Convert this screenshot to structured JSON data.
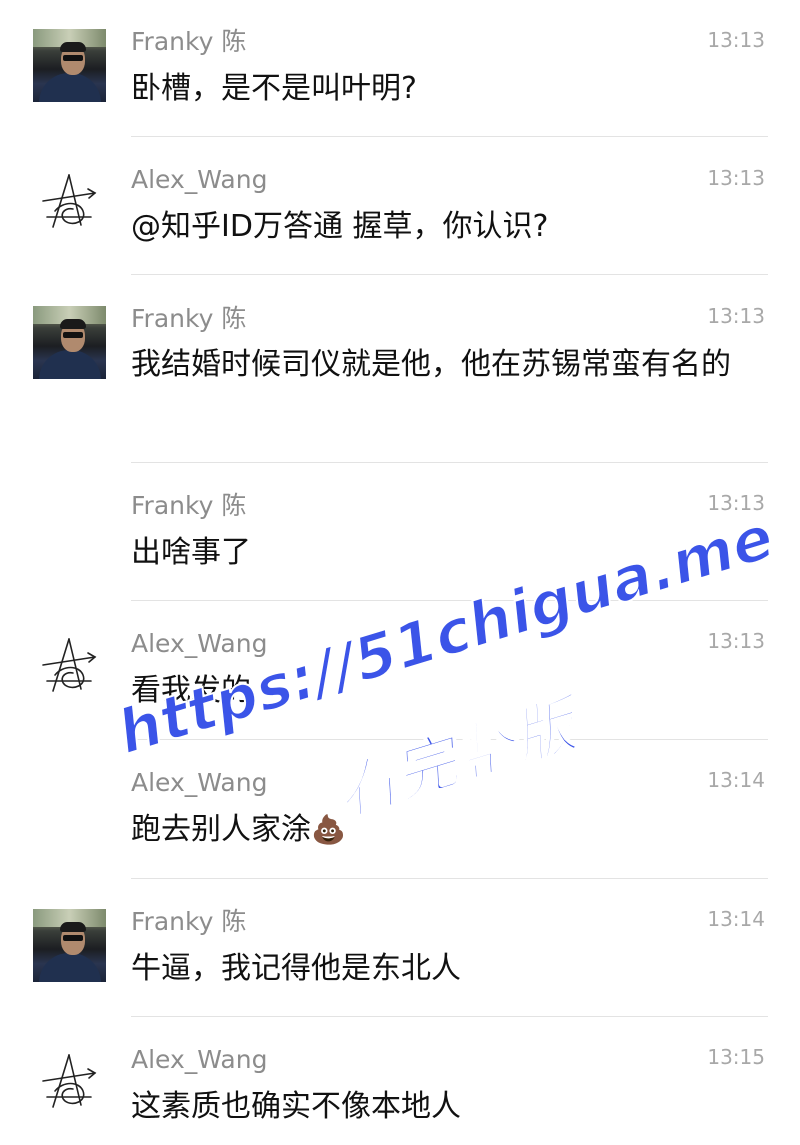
{
  "messages": [
    {
      "sender": "Franky 陈",
      "time": "13:13",
      "text": "卧槽，是不是叫叶明?",
      "avatar": "photo"
    },
    {
      "sender": "Alex_Wang",
      "time": "13:13",
      "text": "@知乎ID万答通 握草，你认识?",
      "avatar": "signature"
    },
    {
      "sender": "Franky 陈",
      "time": "13:13",
      "text": "我结婚时候司仪就是他，他在苏锡常蛮有名的",
      "avatar": "photo"
    },
    {
      "sender": "Franky 陈",
      "time": "13:13",
      "text": "出啥事了",
      "avatar": "none"
    },
    {
      "sender": "Alex_Wang",
      "time": "13:13",
      "text": "看我发的",
      "avatar": "signature"
    },
    {
      "sender": "Alex_Wang",
      "time": "13:14",
      "text": "跑去别人家涂",
      "emoji": "💩",
      "avatar": "none"
    },
    {
      "sender": "Franky 陈",
      "time": "13:14",
      "text": "牛逼，我记得他是东北人",
      "avatar": "photo"
    },
    {
      "sender": "Alex_Wang",
      "time": "13:15",
      "text": "这素质也确实不像本地人",
      "avatar": "signature"
    }
  ],
  "watermark": {
    "url": "https://51chigua.me",
    "caption": "看完整版",
    "color": "#3b54e8"
  },
  "colors": {
    "sender": "#8c8c8c",
    "time": "#a8a8a8",
    "text": "#111111",
    "divider": "#e3e3e3"
  }
}
